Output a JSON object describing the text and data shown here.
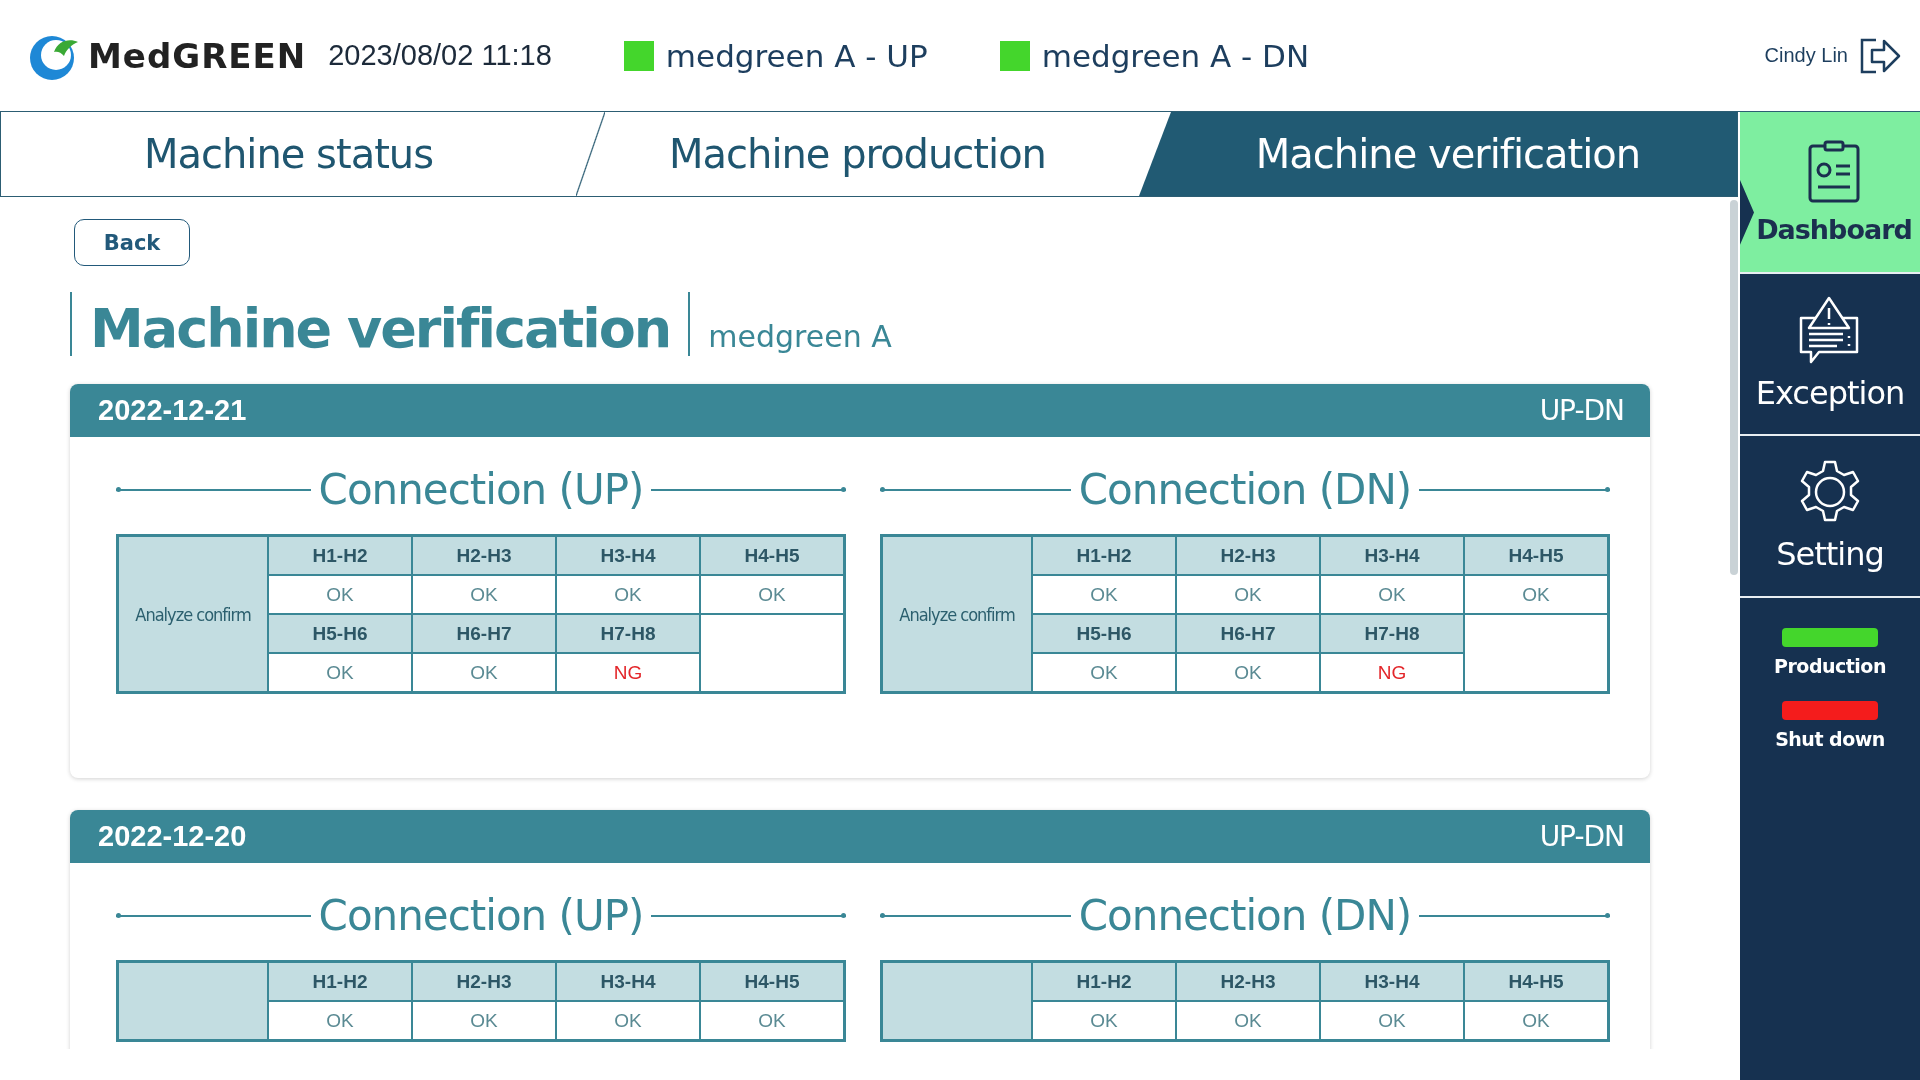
{
  "header": {
    "logo": "MedGREEN",
    "datetime": "2023/08/02 11:18",
    "machines": [
      {
        "name": "medgreen A - UP",
        "color": "#44d62c"
      },
      {
        "name": "medgreen A - DN",
        "color": "#44d62c"
      }
    ],
    "user": "Cindy Lin"
  },
  "tabs": [
    {
      "label": "Machine status",
      "selected": false
    },
    {
      "label": "Machine production",
      "selected": false
    },
    {
      "label": "Machine verification",
      "selected": true
    }
  ],
  "sidebar": {
    "items": [
      {
        "label": "Dashboard",
        "selected": true
      },
      {
        "label": "Exception",
        "selected": false
      },
      {
        "label": "Setting",
        "selected": false
      }
    ],
    "legend": [
      {
        "label": "Production",
        "color": "#44d62c"
      },
      {
        "label": "Shut down",
        "color": "#f41c1c"
      }
    ]
  },
  "back_button": "Back",
  "page_title": "Machine verification",
  "machine": "medgreen A",
  "cards": [
    {
      "date": "2022-12-21",
      "direction": "UP-DN",
      "connections": [
        {
          "title": "Connection (UP)",
          "label": "Analyze confirm",
          "rows": [
            [
              {
                "header": "H1-H2",
                "value": "OK",
                "failed": false
              },
              {
                "header": "H2-H3",
                "value": "OK",
                "failed": false
              },
              {
                "header": "H3-H4",
                "value": "OK",
                "failed": false
              },
              {
                "header": "H4-H5",
                "value": "OK",
                "failed": false
              }
            ],
            [
              {
                "header": "H5-H6",
                "value": "OK",
                "failed": false
              },
              {
                "header": "H6-H7",
                "value": "OK",
                "failed": false
              },
              {
                "header": "H7-H8",
                "value": "NG",
                "failed": true
              }
            ]
          ]
        },
        {
          "title": "Connection (DN)",
          "label": "Analyze confirm",
          "rows": [
            [
              {
                "header": "H1-H2",
                "value": "OK",
                "failed": false
              },
              {
                "header": "H2-H3",
                "value": "OK",
                "failed": false
              },
              {
                "header": "H3-H4",
                "value": "OK",
                "failed": false
              },
              {
                "header": "H4-H5",
                "value": "OK",
                "failed": false
              }
            ],
            [
              {
                "header": "H5-H6",
                "value": "OK",
                "failed": false
              },
              {
                "header": "H6-H7",
                "value": "OK",
                "failed": false
              },
              {
                "header": "H7-H8",
                "value": "NG",
                "failed": true
              }
            ]
          ]
        }
      ]
    },
    {
      "date": "2022-12-20",
      "direction": "UP-DN",
      "connections": [
        {
          "title": "Connection (UP)",
          "rows": [
            [
              {
                "header": "H1-H2",
                "value": "OK",
                "failed": false
              },
              {
                "header": "H2-H3",
                "value": "OK",
                "failed": false
              },
              {
                "header": "H3-H4",
                "value": "OK",
                "failed": false
              },
              {
                "header": "H4-H5",
                "value": "OK",
                "failed": false
              }
            ]
          ]
        },
        {
          "title": "Connection (DN)",
          "rows": [
            [
              {
                "header": "H1-H2",
                "value": "OK",
                "failed": false
              },
              {
                "header": "H2-H3",
                "value": "OK",
                "failed": false
              },
              {
                "header": "H3-H4",
                "value": "OK",
                "failed": false
              },
              {
                "header": "H4-H5",
                "value": "OK",
                "failed": false
              }
            ]
          ]
        }
      ]
    }
  ]
}
